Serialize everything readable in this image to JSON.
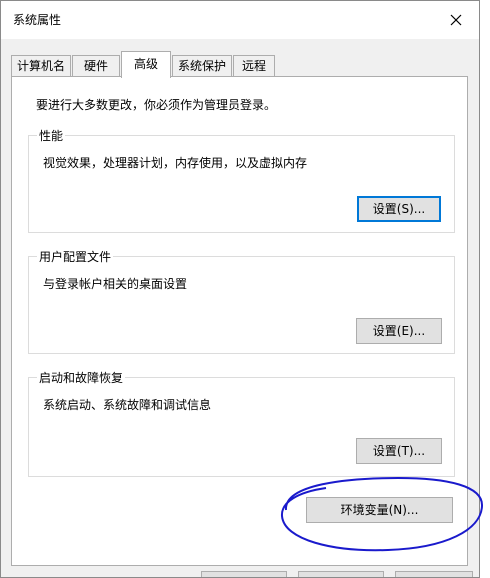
{
  "dialog": {
    "title": "系统属性",
    "close_label": "✕"
  },
  "tabs": [
    {
      "label": "计算机名"
    },
    {
      "label": "硬件"
    },
    {
      "label": "高级"
    },
    {
      "label": "系统保护"
    },
    {
      "label": "远程"
    }
  ],
  "active_tab": "高级",
  "admin_note": "要进行大多数更改，你必须作为管理员登录。",
  "performance": {
    "title": "性能",
    "desc": "视觉效果，处理器计划，内存使用，以及虚拟内存",
    "button": "设置(S)..."
  },
  "user_profiles": {
    "title": "用户配置文件",
    "desc": "与登录帐户相关的桌面设置",
    "button": "设置(E)..."
  },
  "startup_recovery": {
    "title": "启动和故障恢复",
    "desc": "系统启动、系统故障和调试信息",
    "button": "设置(T)..."
  },
  "env_button": "环境变量(N)...",
  "annotation": {
    "color": "#1a1acc"
  }
}
